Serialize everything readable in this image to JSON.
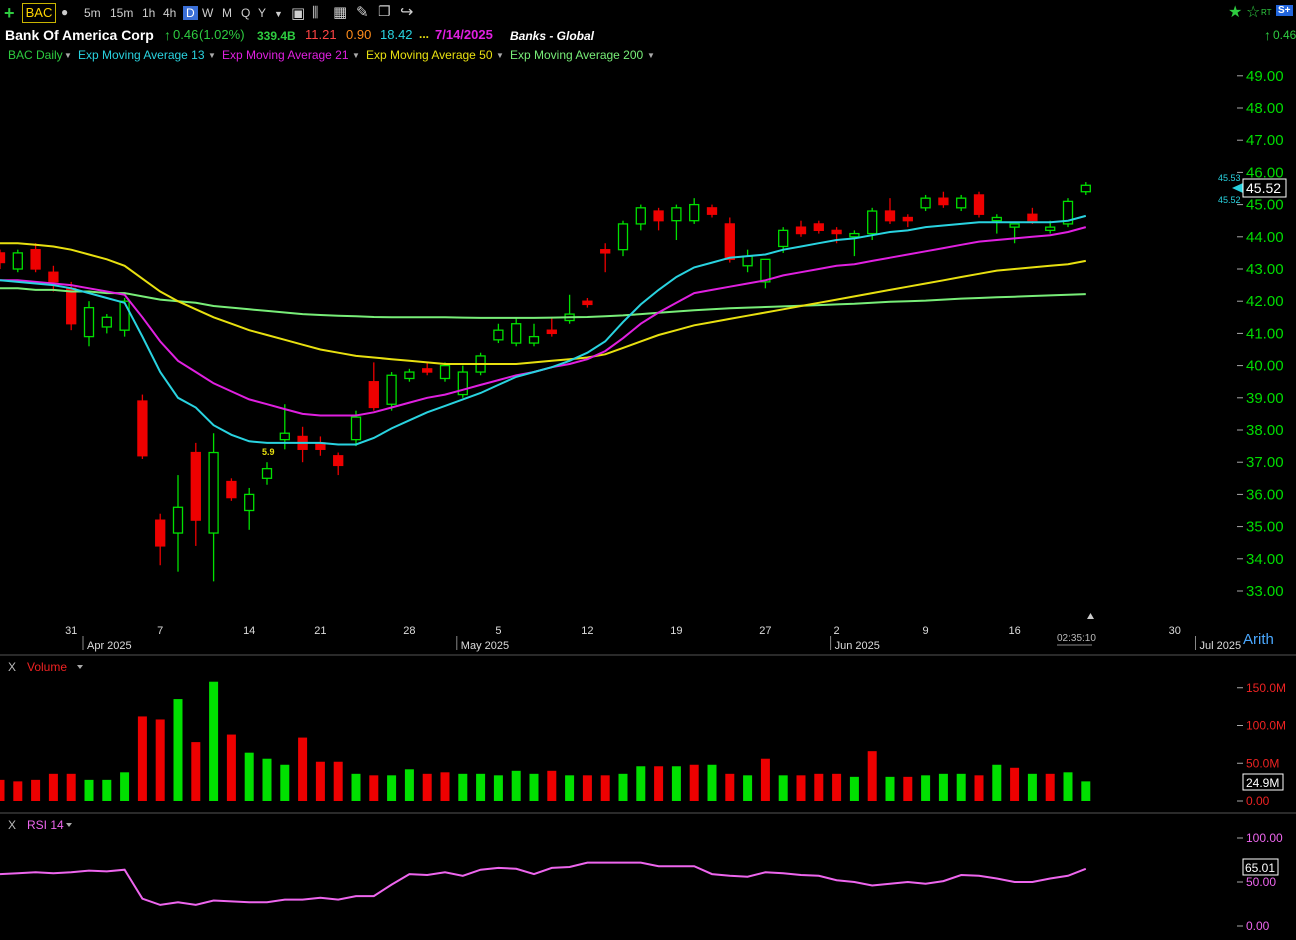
{
  "toolbar": {
    "symbol": "BAC",
    "intervals": [
      "5m",
      "15m",
      "1h",
      "4h",
      "D",
      "W",
      "M",
      "Q",
      "Y"
    ],
    "active_interval": "D",
    "rt": "RT",
    "s_plus": "S+"
  },
  "header": {
    "name": "Bank Of America Corp",
    "change": "0.46",
    "change_pct": "(1.02%)",
    "market_cap": "339.4B",
    "pe": "11.21",
    "val3": "0.90",
    "val4": "18.42",
    "dots": "...",
    "date": "7/14/2025",
    "industry": "Banks - Global",
    "right_change": "0.46"
  },
  "legend": {
    "series": "BAC Daily",
    "ema13": "Exp Moving Average 13",
    "ema21": "Exp Moving Average 21",
    "ema50": "Exp Moving Average 50",
    "ema200": "Exp Moving Average 200"
  },
  "colors": {
    "up": "#00e000",
    "down": "#ee0000",
    "ema13": "#29d3e0",
    "ema21": "#e020e0",
    "ema50": "#e8e010",
    "ema200": "#78ee78",
    "rsi": "#ee66ee",
    "axis_text": "#00dd00"
  },
  "axis": {
    "scale_label": "Arith",
    "time_readout": "02:35:10",
    "marker_label": "5.9",
    "price_current": "45.52",
    "price_hi": "45.53",
    "price_lo": "45.52",
    "volume_current": "24.9M",
    "rsi_current": "65.01"
  },
  "panes": {
    "x": "X",
    "volume_label": "Volume",
    "rsi_label": "RSI 14"
  },
  "chart_data": [
    {
      "type": "candlestick",
      "title": "BAC Daily",
      "y_ticks": [
        33,
        34,
        35,
        36,
        37,
        38,
        39,
        40,
        41,
        42,
        43,
        44,
        45,
        46,
        47,
        48,
        49
      ],
      "ylim": [
        32.5,
        49.5
      ],
      "x_day_labels": [
        "31",
        "7",
        "14",
        "21",
        "28",
        "5",
        "12",
        "19",
        "27",
        "2",
        "9",
        "16",
        "30"
      ],
      "x_month_labels": [
        "Apr 2025",
        "May 2025",
        "Jun 2025",
        "Jul 2025"
      ],
      "candles": [
        {
          "o": 43.5,
          "h": 43.6,
          "l": 43.0,
          "c": 43.2
        },
        {
          "o": 43.0,
          "h": 43.6,
          "l": 42.9,
          "c": 43.5
        },
        {
          "o": 43.6,
          "h": 43.8,
          "l": 42.9,
          "c": 43.0
        },
        {
          "o": 42.9,
          "h": 43.1,
          "l": 42.3,
          "c": 42.6
        },
        {
          "o": 42.4,
          "h": 42.6,
          "l": 41.1,
          "c": 41.3
        },
        {
          "o": 40.9,
          "h": 42.0,
          "l": 40.6,
          "c": 41.8
        },
        {
          "o": 41.2,
          "h": 41.6,
          "l": 41.0,
          "c": 41.5
        },
        {
          "o": 41.1,
          "h": 42.1,
          "l": 40.9,
          "c": 42.0
        },
        {
          "o": 38.9,
          "h": 39.1,
          "l": 37.1,
          "c": 37.2
        },
        {
          "o": 35.2,
          "h": 35.4,
          "l": 33.8,
          "c": 34.4
        },
        {
          "o": 34.8,
          "h": 36.6,
          "l": 33.6,
          "c": 35.6
        },
        {
          "o": 37.3,
          "h": 37.6,
          "l": 34.4,
          "c": 35.2
        },
        {
          "o": 34.8,
          "h": 37.9,
          "l": 33.3,
          "c": 37.3
        },
        {
          "o": 36.4,
          "h": 36.5,
          "l": 35.8,
          "c": 35.9
        },
        {
          "o": 35.5,
          "h": 36.2,
          "l": 34.9,
          "c": 36.0
        },
        {
          "o": 36.5,
          "h": 37.0,
          "l": 36.3,
          "c": 36.8
        },
        {
          "o": 37.7,
          "h": 38.8,
          "l": 37.4,
          "c": 37.9
        },
        {
          "o": 37.8,
          "h": 38.1,
          "l": 37.0,
          "c": 37.4
        },
        {
          "o": 37.6,
          "h": 37.8,
          "l": 37.2,
          "c": 37.4
        },
        {
          "o": 37.2,
          "h": 37.3,
          "l": 36.6,
          "c": 36.9
        },
        {
          "o": 37.7,
          "h": 38.6,
          "l": 37.5,
          "c": 38.4
        },
        {
          "o": 39.5,
          "h": 40.1,
          "l": 38.6,
          "c": 38.7
        },
        {
          "o": 38.8,
          "h": 39.8,
          "l": 38.6,
          "c": 39.7
        },
        {
          "o": 39.6,
          "h": 39.9,
          "l": 39.5,
          "c": 39.8
        },
        {
          "o": 39.9,
          "h": 40.1,
          "l": 39.7,
          "c": 39.8
        },
        {
          "o": 39.6,
          "h": 40.1,
          "l": 39.5,
          "c": 40.0
        },
        {
          "o": 39.1,
          "h": 40.0,
          "l": 39.0,
          "c": 39.8
        },
        {
          "o": 39.8,
          "h": 40.4,
          "l": 39.7,
          "c": 40.3
        },
        {
          "o": 40.8,
          "h": 41.3,
          "l": 40.7,
          "c": 41.1
        },
        {
          "o": 40.7,
          "h": 41.5,
          "l": 40.6,
          "c": 41.3
        },
        {
          "o": 40.7,
          "h": 41.3,
          "l": 40.6,
          "c": 40.9
        },
        {
          "o": 41.1,
          "h": 41.5,
          "l": 40.9,
          "c": 41.0
        },
        {
          "o": 41.4,
          "h": 42.2,
          "l": 41.3,
          "c": 41.6
        },
        {
          "o": 42.0,
          "h": 42.1,
          "l": 41.8,
          "c": 41.9
        },
        {
          "o": 43.6,
          "h": 43.8,
          "l": 42.9,
          "c": 43.5
        },
        {
          "o": 43.6,
          "h": 44.5,
          "l": 43.4,
          "c": 44.4
        },
        {
          "o": 44.4,
          "h": 45.0,
          "l": 44.2,
          "c": 44.9
        },
        {
          "o": 44.8,
          "h": 44.9,
          "l": 44.2,
          "c": 44.5
        },
        {
          "o": 44.5,
          "h": 45.0,
          "l": 43.9,
          "c": 44.9
        },
        {
          "o": 44.5,
          "h": 45.2,
          "l": 44.4,
          "c": 45.0
        },
        {
          "o": 44.9,
          "h": 45.0,
          "l": 44.6,
          "c": 44.7
        },
        {
          "o": 44.4,
          "h": 44.6,
          "l": 43.2,
          "c": 43.3
        },
        {
          "o": 43.1,
          "h": 43.6,
          "l": 42.9,
          "c": 43.4
        },
        {
          "o": 42.6,
          "h": 43.3,
          "l": 42.4,
          "c": 43.3
        },
        {
          "o": 43.7,
          "h": 44.3,
          "l": 43.5,
          "c": 44.2
        },
        {
          "o": 44.3,
          "h": 44.5,
          "l": 44.0,
          "c": 44.1
        },
        {
          "o": 44.4,
          "h": 44.5,
          "l": 44.1,
          "c": 44.2
        },
        {
          "o": 44.2,
          "h": 44.3,
          "l": 43.8,
          "c": 44.1
        },
        {
          "o": 44.0,
          "h": 44.2,
          "l": 43.4,
          "c": 44.1
        },
        {
          "o": 44.1,
          "h": 44.9,
          "l": 43.9,
          "c": 44.8
        },
        {
          "o": 44.8,
          "h": 45.2,
          "l": 44.4,
          "c": 44.5
        },
        {
          "o": 44.6,
          "h": 44.7,
          "l": 44.3,
          "c": 44.5
        },
        {
          "o": 44.9,
          "h": 45.3,
          "l": 44.8,
          "c": 45.2
        },
        {
          "o": 45.2,
          "h": 45.4,
          "l": 44.9,
          "c": 45.0
        },
        {
          "o": 44.9,
          "h": 45.3,
          "l": 44.8,
          "c": 45.2
        },
        {
          "o": 45.3,
          "h": 45.4,
          "l": 44.6,
          "c": 44.7
        },
        {
          "o": 44.5,
          "h": 44.7,
          "l": 44.1,
          "c": 44.6
        },
        {
          "o": 44.3,
          "h": 44.4,
          "l": 43.8,
          "c": 44.4
        },
        {
          "o": 44.7,
          "h": 44.9,
          "l": 44.4,
          "c": 44.5
        },
        {
          "o": 44.2,
          "h": 44.5,
          "l": 44.1,
          "c": 44.3
        },
        {
          "o": 44.4,
          "h": 45.2,
          "l": 44.3,
          "c": 45.1
        },
        {
          "o": 45.4,
          "h": 45.7,
          "l": 45.3,
          "c": 45.6
        }
      ],
      "ema13": [
        42.65,
        42.6,
        42.55,
        42.5,
        42.4,
        42.25,
        42.1,
        41.95,
        40.9,
        39.8,
        39.0,
        38.7,
        38.15,
        37.85,
        37.65,
        37.6,
        37.6,
        37.6,
        37.6,
        37.55,
        37.55,
        37.75,
        38.05,
        38.3,
        38.55,
        38.75,
        38.95,
        39.15,
        39.4,
        39.65,
        39.8,
        39.95,
        40.15,
        40.4,
        40.75,
        41.35,
        41.9,
        42.35,
        42.75,
        43.05,
        43.2,
        43.35,
        43.4,
        43.45,
        43.6,
        43.7,
        43.8,
        43.9,
        43.95,
        44.05,
        44.15,
        44.2,
        44.3,
        44.35,
        44.4,
        44.45,
        44.45,
        44.45,
        44.45,
        44.45,
        44.5,
        44.65
      ],
      "ema21": [
        42.65,
        42.65,
        42.6,
        42.55,
        42.5,
        42.4,
        42.3,
        42.2,
        41.5,
        40.75,
        40.15,
        39.8,
        39.45,
        39.2,
        38.95,
        38.8,
        38.65,
        38.5,
        38.45,
        38.45,
        38.45,
        38.55,
        38.7,
        38.85,
        39.0,
        39.1,
        39.25,
        39.4,
        39.55,
        39.7,
        39.8,
        39.95,
        40.05,
        40.2,
        40.45,
        40.85,
        41.3,
        41.65,
        41.95,
        42.25,
        42.35,
        42.45,
        42.55,
        42.65,
        42.8,
        42.9,
        43.0,
        43.1,
        43.15,
        43.25,
        43.35,
        43.45,
        43.55,
        43.65,
        43.75,
        43.85,
        43.9,
        43.95,
        44.0,
        44.05,
        44.15,
        44.3
      ],
      "ema50": [
        43.8,
        43.8,
        43.75,
        43.7,
        43.6,
        43.45,
        43.3,
        43.1,
        42.7,
        42.3,
        42.0,
        41.75,
        41.5,
        41.3,
        41.1,
        40.95,
        40.8,
        40.65,
        40.5,
        40.4,
        40.3,
        40.25,
        40.2,
        40.15,
        40.1,
        40.05,
        40.05,
        40.05,
        40.05,
        40.05,
        40.1,
        40.15,
        40.2,
        40.25,
        40.35,
        40.55,
        40.75,
        40.95,
        41.1,
        41.25,
        41.35,
        41.45,
        41.55,
        41.65,
        41.75,
        41.85,
        41.95,
        42.05,
        42.15,
        42.25,
        42.35,
        42.45,
        42.55,
        42.65,
        42.75,
        42.85,
        42.95,
        43.0,
        43.05,
        43.1,
        43.15,
        43.25
      ],
      "ema200": [
        42.4,
        42.4,
        42.35,
        42.35,
        42.3,
        42.3,
        42.25,
        42.25,
        42.15,
        42.05,
        42.0,
        41.95,
        41.85,
        41.8,
        41.75,
        41.7,
        41.65,
        41.6,
        41.57,
        41.55,
        41.53,
        41.51,
        41.5,
        41.5,
        41.5,
        41.5,
        41.49,
        41.48,
        41.48,
        41.48,
        41.48,
        41.49,
        41.5,
        41.51,
        41.53,
        41.56,
        41.6,
        41.64,
        41.68,
        41.72,
        41.75,
        41.78,
        41.8,
        41.82,
        41.84,
        41.86,
        41.88,
        41.9,
        41.92,
        41.95,
        41.98,
        42.0,
        42.02,
        42.05,
        42.08,
        42.1,
        42.12,
        42.14,
        42.16,
        42.18,
        42.2,
        42.22
      ]
    },
    {
      "type": "bar",
      "title": "Volume",
      "y_ticks": [
        "150.0M",
        "100.0M",
        "50.0M",
        "0.00"
      ],
      "ylim_millions": [
        0,
        160
      ],
      "values_millions": [
        28,
        26,
        28,
        36,
        36,
        28,
        28,
        38,
        112,
        108,
        135,
        78,
        158,
        88,
        64,
        56,
        48,
        84,
        52,
        52,
        36,
        34,
        34,
        42,
        36,
        38,
        36,
        36,
        34,
        40,
        36,
        40,
        34,
        34,
        34,
        36,
        46,
        46,
        46,
        48,
        48,
        36,
        34,
        56,
        34,
        34,
        36,
        36,
        32,
        66,
        32,
        32,
        34,
        36,
        36,
        34,
        48,
        44,
        36,
        36,
        38,
        26
      ],
      "up": [
        false,
        false,
        false,
        false,
        false,
        true,
        true,
        true,
        false,
        false,
        true,
        false,
        true,
        false,
        true,
        true,
        true,
        false,
        false,
        false,
        true,
        false,
        true,
        true,
        false,
        false,
        true,
        true,
        true,
        true,
        true,
        false,
        true,
        false,
        false,
        true,
        true,
        false,
        true,
        false,
        true,
        false,
        true,
        false,
        true,
        false,
        false,
        false,
        true,
        false,
        true,
        false,
        true,
        true,
        true,
        false,
        true,
        false,
        true,
        false,
        true,
        true
      ]
    },
    {
      "type": "line",
      "title": "RSI 14",
      "y_ticks": [
        "100.00",
        "50.00",
        "0.00"
      ],
      "ylim": [
        0,
        100
      ],
      "values": [
        59,
        60,
        61,
        60,
        61,
        63,
        62,
        64,
        31,
        24,
        27,
        24,
        29,
        28,
        27,
        27,
        30,
        30,
        32,
        30,
        34,
        34,
        47,
        59,
        58,
        61,
        57,
        64,
        66,
        65,
        59,
        66,
        67,
        72,
        72,
        72,
        72,
        68,
        68,
        68,
        59,
        57,
        56,
        61,
        60,
        58,
        57,
        52,
        50,
        46,
        48,
        50,
        48,
        51,
        58,
        57,
        54,
        50,
        50,
        54,
        57,
        65
      ]
    }
  ]
}
